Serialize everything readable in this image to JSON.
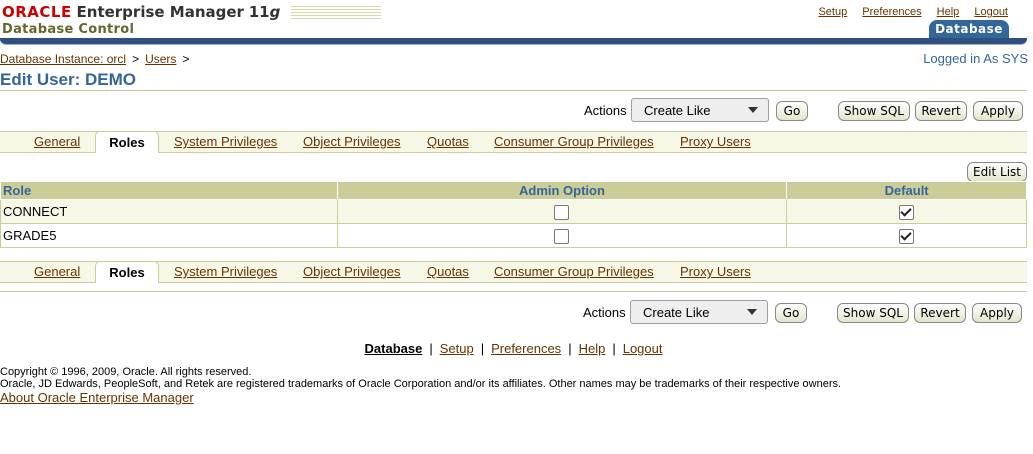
{
  "header": {
    "brand_oracle": "ORACLE",
    "brand_product": "Enterprise Manager",
    "brand_version_num": "11",
    "brand_version_g": "g",
    "brand_subtitle": "Database Control",
    "global_links": [
      "Setup",
      "Preferences",
      "Help",
      "Logout"
    ],
    "target_tab": "Database"
  },
  "breadcrumb": {
    "items": [
      "Database Instance: orcl",
      "Users"
    ],
    "separator": ">"
  },
  "logged_in": "Logged in As SYS",
  "page_title": "Edit User: DEMO",
  "actions": {
    "label": "Actions",
    "selected": "Create Like",
    "go": "Go",
    "show_sql": "Show SQL",
    "revert": "Revert",
    "apply": "Apply"
  },
  "tabs": [
    "General",
    "Roles",
    "System Privileges",
    "Object Privileges",
    "Quotas",
    "Consumer Group Privileges",
    "Proxy Users"
  ],
  "active_tab": "Roles",
  "edit_list": "Edit List",
  "table": {
    "headers": [
      "Role",
      "Admin Option",
      "Default"
    ],
    "rows": [
      {
        "role": "CONNECT",
        "admin_option": false,
        "default": true
      },
      {
        "role": "GRADE5",
        "admin_option": false,
        "default": true
      }
    ]
  },
  "footer": {
    "links": [
      "Database",
      "Setup",
      "Preferences",
      "Help",
      "Logout"
    ],
    "separator": "|",
    "copyright": "Copyright © 1996, 2009, Oracle. All rights reserved.",
    "trademark": "Oracle, JD Edwards, PeopleSoft, and Retek are registered trademarks of Oracle Corporation and/or its affiliates. Other names may be trademarks of their respective owners.",
    "about": "About Oracle Enterprise Manager"
  },
  "colors": {
    "accent_blue": "#336699",
    "link_brown": "#663300",
    "oracle_red": "#cc0000",
    "khaki": "#cccc99",
    "header_bar": "#2f4f7f"
  }
}
